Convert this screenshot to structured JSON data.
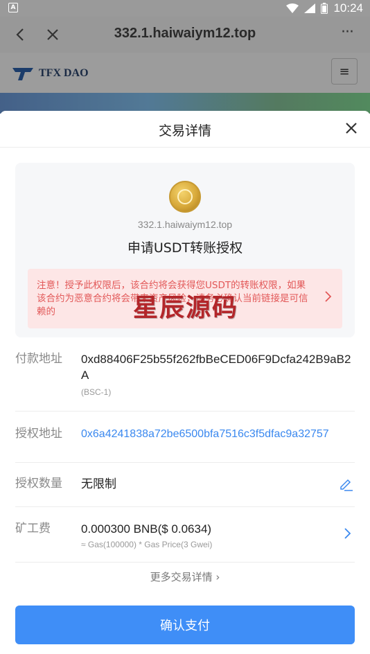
{
  "status_bar": {
    "time": "10:24",
    "left_badge": "A"
  },
  "browser": {
    "title": "332.1.haiwaiym12.top",
    "more": "···"
  },
  "site": {
    "logo_text": "TFX DAO",
    "menu_icon": "≡"
  },
  "sheet": {
    "title": "交易详情"
  },
  "card": {
    "domain": "332.1.haiwaiym12.top",
    "action": "申请USDT转账授权",
    "warning": "注意！授予此权限后，该合约将会获得您USDT的转账权限，如果该合约为恶意合约将会带来资产风险，请务必确认当前链接是可信赖的",
    "watermark": "星辰源码"
  },
  "rows": {
    "payer_label": "付款地址",
    "payer_value": "0xd88406F25b55f262fbBeCED06F9Dcfa242B9aB2A",
    "payer_chain": "(BSC-1)",
    "auth_label": "授权地址",
    "auth_value": "0x6a4241838a72be6500bfa7516c3f5dfac9a32757",
    "amount_label": "授权数量",
    "amount_value": "无限制",
    "fee_label": "矿工费",
    "fee_value": "0.000300 BNB($ 0.0634)",
    "fee_sub": "≈ Gas(100000) * Gas Price(3 Gwei)"
  },
  "more_details": "更多交易详情 ›",
  "confirm_label": "确认支付",
  "colors": {
    "primary": "#3f8ef7",
    "warning_text": "#e25858",
    "warning_bg": "#fde6e6",
    "link": "#3a88ef"
  }
}
